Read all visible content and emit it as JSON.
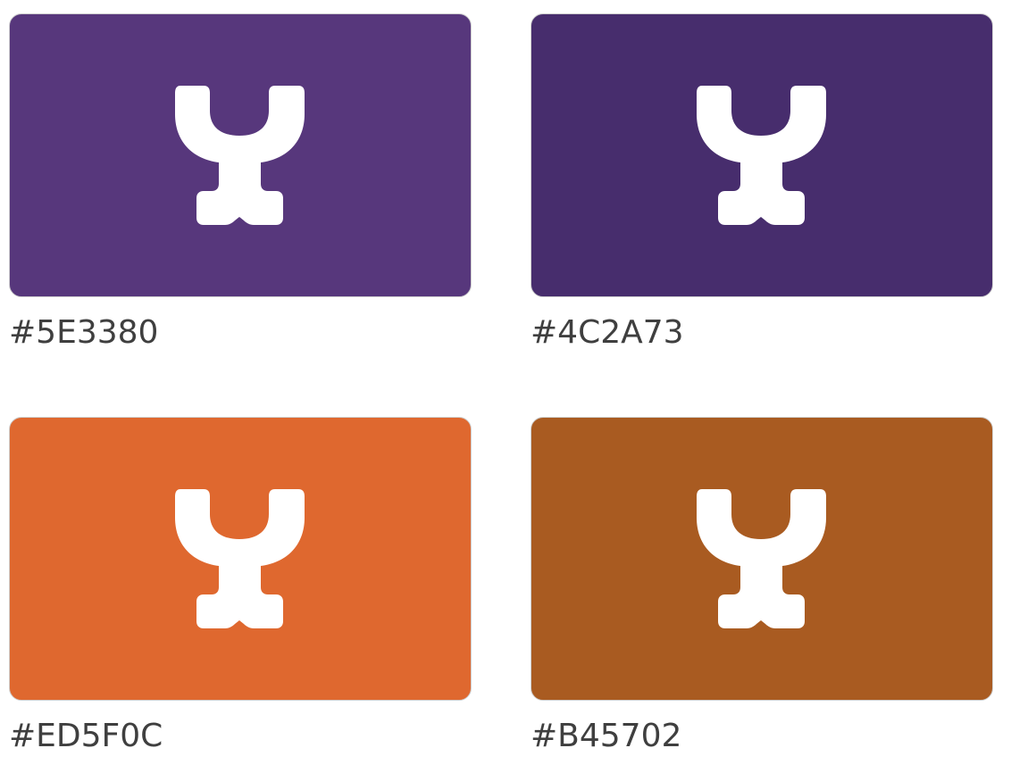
{
  "swatches": [
    {
      "label": "#5E3380",
      "fill": "#57377C",
      "icon": "brand-logo-icon"
    },
    {
      "label": "#4C2A73",
      "fill": "#472D6D",
      "icon": "brand-logo-icon"
    },
    {
      "label": "#ED5F0C",
      "fill": "#DF682F",
      "icon": "brand-logo-icon"
    },
    {
      "label": "#B45702",
      "fill": "#A95B21",
      "icon": "brand-logo-icon"
    }
  ],
  "icon_color": "#FFFFFF",
  "label_color": "#3F3F3F"
}
